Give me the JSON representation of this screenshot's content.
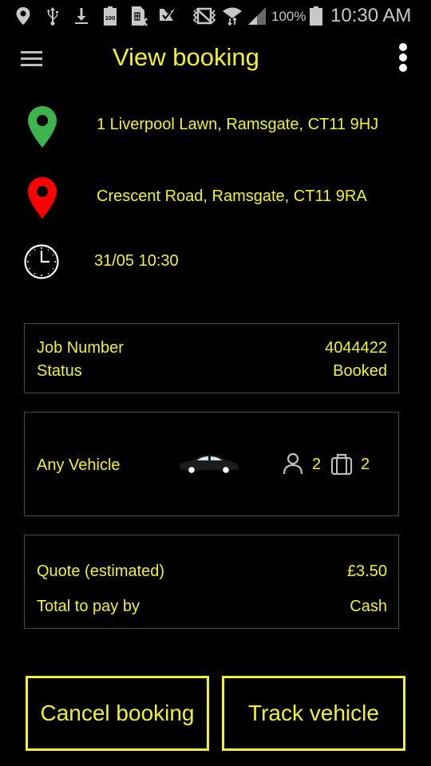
{
  "status_bar": {
    "icons_left": [
      "location-icon",
      "usb-icon",
      "download-icon",
      "battery-100-icon",
      "no-sim-icon",
      "checkmark-notification-icon"
    ],
    "icons_right": [
      "vibrate-mute-icon",
      "wifi-icon",
      "cell-signal-icon",
      "battery-icon"
    ],
    "battery_percent": "100%",
    "time": "10:30 AM"
  },
  "app_bar": {
    "title": "View booking",
    "menu_icon": "hamburger-menu-icon",
    "overflow_icon": "more-vertical-icon"
  },
  "trip": {
    "pickup": {
      "icon": "pickup-pin-icon",
      "color": "#3cb44b",
      "address": "1 Liverpool Lawn, Ramsgate, CT11 9HJ"
    },
    "dropoff": {
      "icon": "dropoff-pin-icon",
      "color": "#ff0000",
      "address": "Crescent Road, Ramsgate, CT11 9RA"
    },
    "time": {
      "icon": "clock-icon",
      "value": "31/05 10:30"
    }
  },
  "job_card": {
    "rows": [
      {
        "label": "Job Number",
        "value": "4044422"
      },
      {
        "label": "Status",
        "value": "Booked"
      }
    ]
  },
  "vehicle_card": {
    "vehicle_type": "Any Vehicle",
    "vehicle_icon": "car-icon",
    "passengers": "2",
    "luggage": "2"
  },
  "price_card": {
    "rows": [
      {
        "label": "Quote (estimated)",
        "value": "£3.50"
      },
      {
        "label": "Total to pay by",
        "value": "Cash"
      }
    ]
  },
  "actions": {
    "cancel_label": "Cancel booking",
    "track_label": "Track vehicle"
  },
  "colors": {
    "accent": "#f2f22a",
    "card_border": "#2e5a3e",
    "background": "#000000"
  }
}
